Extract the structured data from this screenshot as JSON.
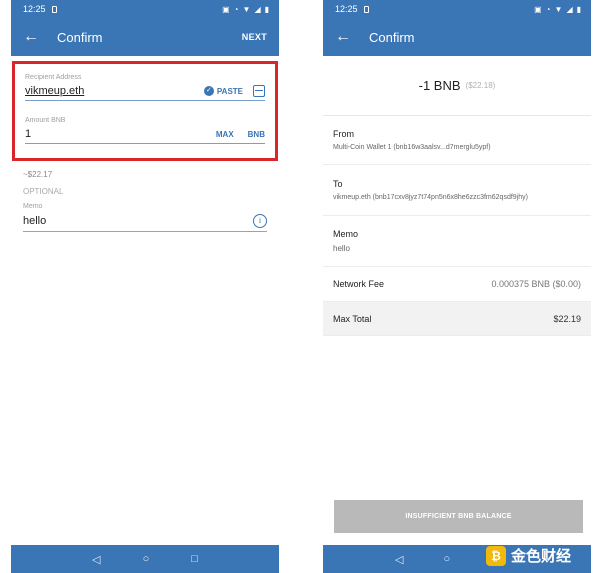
{
  "left": {
    "status": {
      "time": "12:25"
    },
    "appbar": {
      "back": "←",
      "title": "Confirm",
      "next": "NEXT"
    },
    "recipient": {
      "label": "Recipient Address",
      "value": "vikmeup.eth",
      "paste": "PASTE"
    },
    "amount": {
      "label": "Amount BNB",
      "value": "1",
      "max": "MAX",
      "unit": "BNB",
      "usd": "~$22.17"
    },
    "optional": "OPTIONAL",
    "memo": {
      "label": "Memo",
      "value": "hello",
      "info": "i"
    },
    "nav": {
      "back": "◁",
      "home": "○",
      "recent": "□"
    }
  },
  "right": {
    "status": {
      "time": "12:25"
    },
    "appbar": {
      "back": "←",
      "title": "Confirm"
    },
    "amount": {
      "main": "-1 BNB",
      "usd": "($22.18)"
    },
    "from": {
      "label": "From",
      "value": "Multi-Coin Wallet 1 (bnb16w3aalsv...d7merglu5ypf)"
    },
    "to": {
      "label": "To",
      "value": "vikmeup.eth (bnb17cxv8jyz7t74pn5n6x8he6zzc3fm62qsdf9jhy)"
    },
    "memo": {
      "label": "Memo",
      "value": "hello"
    },
    "fee": {
      "label": "Network Fee",
      "value": "0.000375 BNB ($0.00)"
    },
    "total": {
      "label": "Max Total",
      "value": "$22.19"
    },
    "button": "INSUFFICIENT BNB BALANCE",
    "nav": {
      "back": "◁",
      "home": "○"
    }
  },
  "watermark": {
    "text": "金色财经"
  },
  "colors": {
    "primary": "#3a75b5",
    "highlight": "#d9262c",
    "disabled": "#b9b9b9"
  }
}
